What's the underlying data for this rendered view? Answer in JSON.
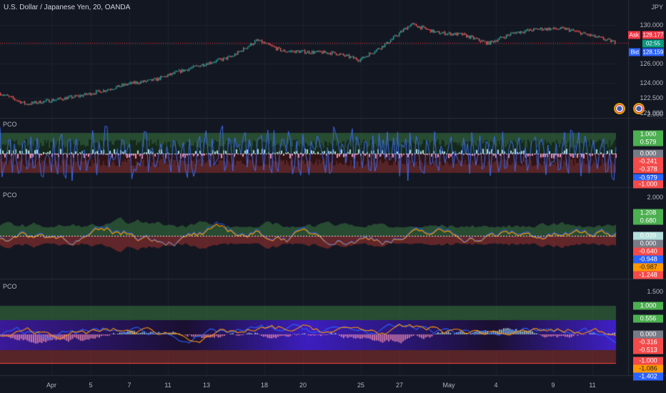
{
  "header": {
    "title": "U.S. Dollar / Japanese Yen, 20, OANDA",
    "currency": "JPY"
  },
  "main_axis": {
    "ticks": [
      "130.000",
      "126.000",
      "124.000",
      "122.500",
      "121.000"
    ],
    "ask_label": "Ask",
    "ask": "128.177",
    "countdown": "02:55",
    "bid_label": "Bid",
    "bid": "128.159"
  },
  "panes": [
    {
      "label": "PCO",
      "ticks": [
        "2.000"
      ],
      "tags": [
        {
          "v": "1.000",
          "c": "#4caf50"
        },
        {
          "v": "0.579",
          "c": "#4caf50"
        },
        {
          "v": "0.000",
          "c": "#787b86"
        },
        {
          "v": "-0.241",
          "c": "#f44a4a"
        },
        {
          "v": "-0.378",
          "c": "#f44a4a"
        },
        {
          "v": "-0.979",
          "c": "#2962ff"
        },
        {
          "v": "-1.000",
          "c": "#f44a4a"
        }
      ]
    },
    {
      "label": "PCO",
      "ticks": [
        "2.000"
      ],
      "tags": [
        {
          "v": "1.208",
          "c": "#4caf50"
        },
        {
          "v": "0.680",
          "c": "#4caf50"
        },
        {
          "v": "0.039",
          "c": "#b2dfdb"
        },
        {
          "v": "0.000",
          "c": "#787b86"
        },
        {
          "v": "-0.640",
          "c": "#f44a4a"
        },
        {
          "v": "-0.948",
          "c": "#2962ff"
        },
        {
          "v": "-0.987",
          "c": "#ff9800"
        },
        {
          "v": "-1.248",
          "c": "#f44a4a"
        }
      ]
    },
    {
      "label": "PCO",
      "ticks": [
        "1.500"
      ],
      "tags": [
        {
          "v": "1.000",
          "c": "#4caf50"
        },
        {
          "v": "0.556",
          "c": "#4caf50"
        },
        {
          "v": "0.000",
          "c": "#787b86"
        },
        {
          "v": "-0.316",
          "c": "#f44a4a"
        },
        {
          "v": "-0.513",
          "c": "#f44a4a"
        },
        {
          "v": "-1.000",
          "c": "#f44a4a"
        },
        {
          "v": "-1.086",
          "c": "#ff9800"
        },
        {
          "v": "-1.402",
          "c": "#2962ff"
        }
      ]
    }
  ],
  "chart_data": {
    "type": "line",
    "symbol": "USDJPY",
    "x_labels": [
      "Apr",
      "5",
      "7",
      "11",
      "13",
      "18",
      "20",
      "25",
      "27",
      "May",
      "4",
      "9",
      "11"
    ],
    "price_path": [
      122.9,
      121.8,
      122.2,
      122.6,
      123.2,
      123.9,
      124.3,
      125.2,
      126.0,
      126.7,
      128.4,
      127.3,
      127.2,
      127.1,
      126.4,
      128.0,
      130.1,
      129.2,
      129.0,
      128.1,
      129.2,
      129.6,
      129.6,
      128.9,
      128.17
    ],
    "ylim": [
      121.0,
      130.6
    ]
  },
  "colors": {
    "up": "#26a69a",
    "down": "#ef5350",
    "blue": "#2962ff",
    "orange": "#ff9800"
  }
}
